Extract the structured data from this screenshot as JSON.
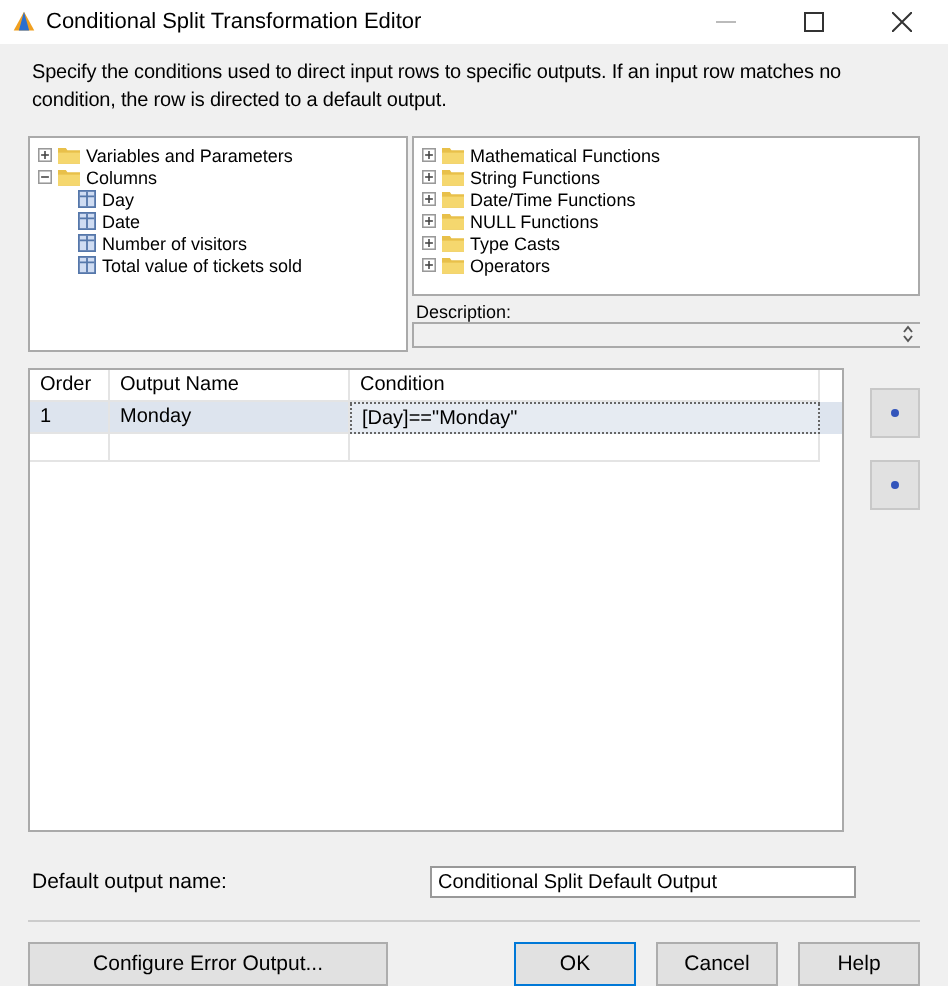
{
  "window": {
    "title": "Conditional Split Transformation Editor"
  },
  "instructions": "Specify the conditions used to direct input rows to specific outputs. If an input row matches no condition, the row is directed to a default output.",
  "input_tree": [
    {
      "label": "Variables and Parameters",
      "expanded": false
    },
    {
      "label": "Columns",
      "expanded": true,
      "children": [
        {
          "label": "Day"
        },
        {
          "label": "Date"
        },
        {
          "label": "Number of visitors"
        },
        {
          "label": "Total value of tickets sold"
        }
      ]
    }
  ],
  "function_tree": [
    {
      "label": "Mathematical Functions",
      "expanded": false
    },
    {
      "label": "String Functions",
      "expanded": false
    },
    {
      "label": "Date/Time Functions",
      "expanded": false
    },
    {
      "label": "NULL Functions",
      "expanded": false
    },
    {
      "label": "Type Casts",
      "expanded": false
    },
    {
      "label": "Operators",
      "expanded": false
    }
  ],
  "description_label": "Description:",
  "grid": {
    "columns": [
      "Order",
      "Output Name",
      "Condition"
    ],
    "rows": [
      {
        "order": "1",
        "output_name": "Monday",
        "condition": "[Day]==\"Monday\"",
        "selected": true
      }
    ]
  },
  "default_output": {
    "label": "Default output name:",
    "value": "Conditional Split Default Output"
  },
  "buttons": {
    "configure": "Configure Error Output...",
    "ok": "OK",
    "cancel": "Cancel",
    "help": "Help"
  }
}
